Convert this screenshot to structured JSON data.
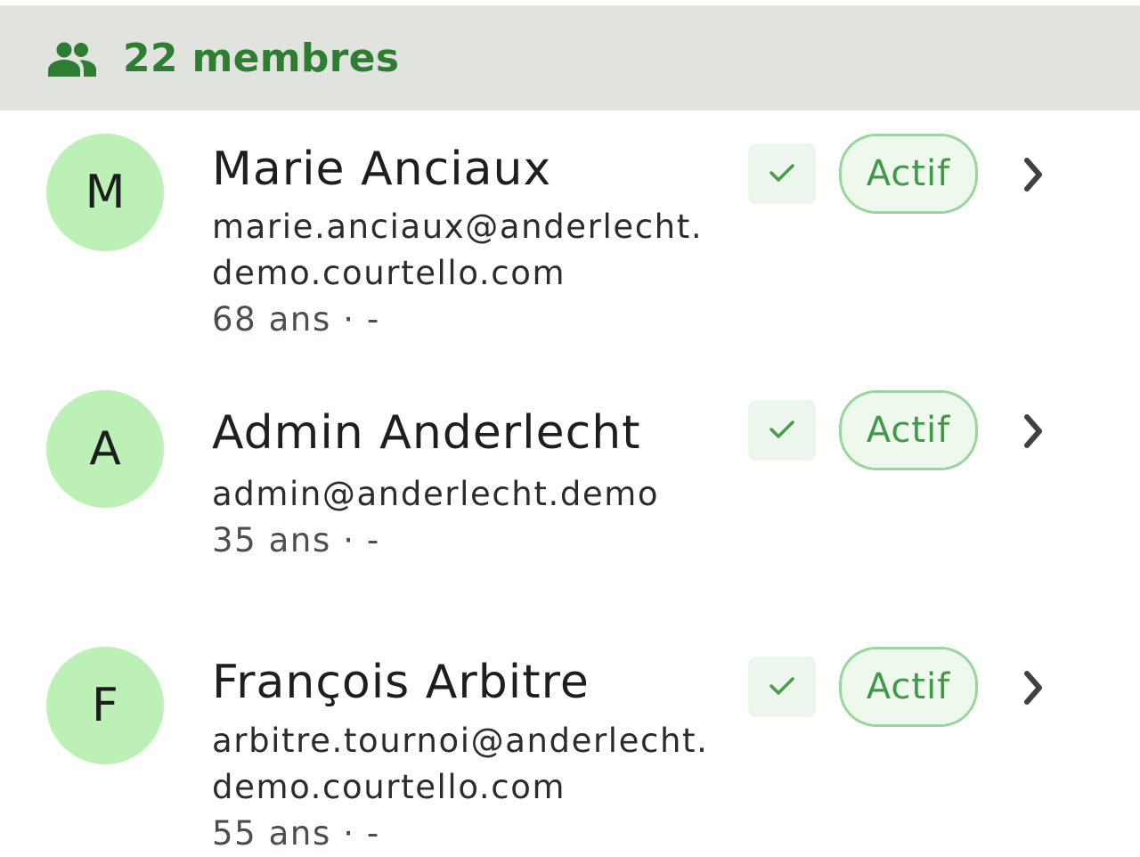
{
  "header": {
    "icon": "people-icon",
    "count_label": "22 membres"
  },
  "colors": {
    "accent": "#2e7d32",
    "avatar_bg": "#bdf0b7",
    "chip_border": "#9ad59b",
    "chip_text": "#3e9a45",
    "header_bg": "#e1e4de"
  },
  "members": [
    {
      "initial": "M",
      "name": "Marie Anciaux",
      "email_line1": "marie.anciaux@anderlecht.",
      "email_line2": "demo.courtello.com",
      "meta": "68 ans · -",
      "status": "Actif",
      "checked": true
    },
    {
      "initial": "A",
      "name": "Admin Anderlecht",
      "email_line1": "admin@anderlecht.demo",
      "email_line2": "",
      "meta": "35 ans · -",
      "status": "Actif",
      "checked": true
    },
    {
      "initial": "F",
      "name": "François Arbitre",
      "email_line1": "arbitre.tournoi@anderlecht.",
      "email_line2": "demo.courtello.com",
      "meta": "55 ans · -",
      "status": "Actif",
      "checked": true
    }
  ]
}
